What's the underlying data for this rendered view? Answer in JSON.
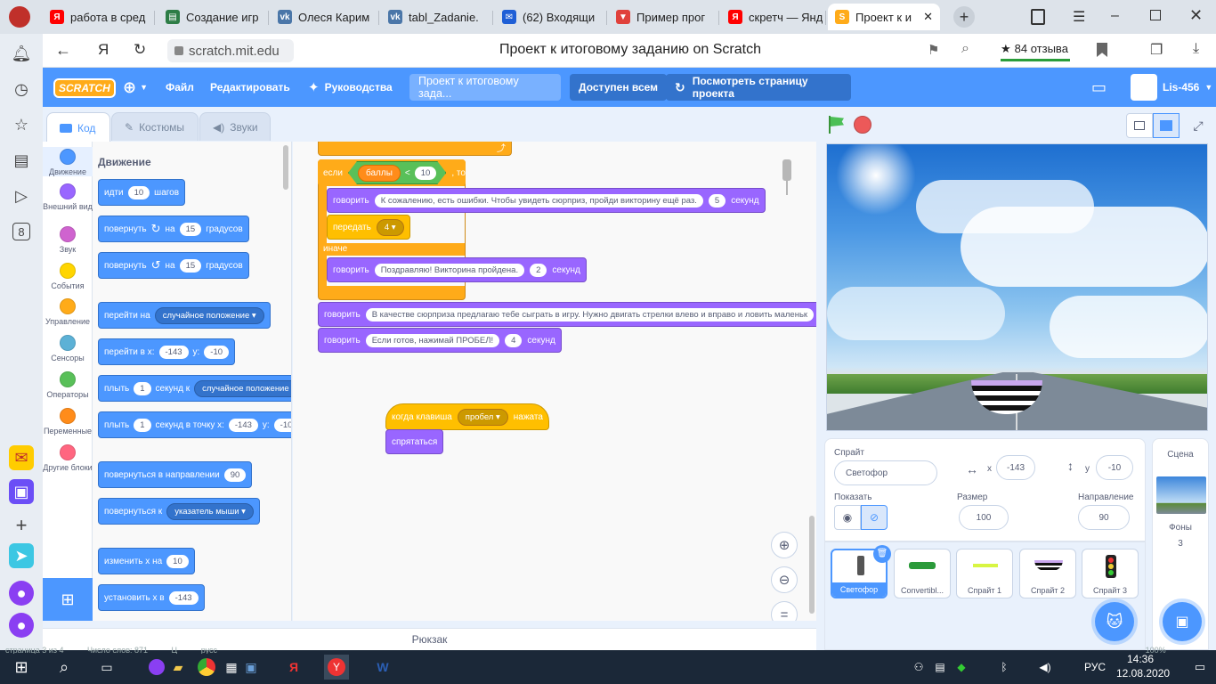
{
  "browser": {
    "tabs": [
      {
        "label": "работа в сред",
        "fav": "Я",
        "color": "#ff0000"
      },
      {
        "label": "Создание игр",
        "fav": "▤",
        "color": "#2d7d46"
      },
      {
        "label": "Олеся Карим",
        "fav": "vk",
        "color": "#4a76a8"
      },
      {
        "label": "tabl_Zadanie.",
        "fav": "vk",
        "color": "#4a76a8"
      },
      {
        "label": "(62) Входящи",
        "fav": "✉",
        "color": "#1f5fd6"
      },
      {
        "label": "Пример прог",
        "fav": "▼",
        "color": "#e0413b"
      },
      {
        "label": "скретч — Янд",
        "fav": "Я",
        "color": "#ff0000"
      },
      {
        "label": "Проект к и",
        "fav": "S",
        "color": "#ffab19"
      }
    ],
    "url": "scratch.mit.edu",
    "page_title": "Проект к итоговому заданию on Scratch",
    "reviews": "84 отзыва"
  },
  "menubar": {
    "logo": "SCRATCH",
    "file": "Файл",
    "edit": "Редактировать",
    "tutorials": "Руководства",
    "project_title": "Проект к итоговому зада...",
    "share": "Доступен всем",
    "see_project": "Посмотреть страницу проекта",
    "username": "Lis-456"
  },
  "editor_tabs": {
    "code": "Код",
    "costumes": "Костюмы",
    "sounds": "Звуки"
  },
  "categories": [
    {
      "label": "Движение",
      "color": "#4c97ff"
    },
    {
      "label": "Внешний вид",
      "color": "#9966ff"
    },
    {
      "label": "Звук",
      "color": "#cf63cf"
    },
    {
      "label": "События",
      "color": "#ffd500"
    },
    {
      "label": "Управление",
      "color": "#ffab19"
    },
    {
      "label": "Сенсоры",
      "color": "#5cb1d6"
    },
    {
      "label": "Операторы",
      "color": "#59c059"
    },
    {
      "label": "Переменные",
      "color": "#ff8c1a"
    },
    {
      "label": "Другие блоки",
      "color": "#ff6680"
    }
  ],
  "palette": {
    "heading": "Движение",
    "move": {
      "t1": "идти",
      "v": "10",
      "t2": "шагов"
    },
    "turn_right": {
      "t1": "повернуть",
      "t2": "на",
      "v": "15",
      "t3": "градусов"
    },
    "turn_left": {
      "t1": "повернуть",
      "t2": "на",
      "v": "15",
      "t3": "градусов"
    },
    "goto": {
      "t1": "перейти на",
      "dd": "случайное положение"
    },
    "goto_xy": {
      "t1": "перейти в x:",
      "x": "-143",
      "t2": "y:",
      "y": "-10"
    },
    "glide": {
      "t1": "плыть",
      "v": "1",
      "t2": "секунд к",
      "dd": "случайное положение"
    },
    "glide_xy": {
      "t1": "плыть",
      "v": "1",
      "t2": "секунд в точку x:",
      "x": "-143",
      "t3": "y:",
      "y": "-10"
    },
    "point_dir": {
      "t1": "повернуться в направлении",
      "v": "90"
    },
    "point_towards": {
      "t1": "повернуться к",
      "dd": "указатель мыши"
    },
    "change_x": {
      "t1": "изменить x на",
      "v": "10"
    },
    "set_x": {
      "t1": "установить x в",
      "v": "-143"
    }
  },
  "script": {
    "if_label": "если",
    "then_label": ", то",
    "var": "баллы",
    "op": "<",
    "op_value": "10",
    "say1": {
      "t1": "говорить",
      "text": "К сожалению, есть ошибки. Чтобы увидеть сюрприз, пройди викторину ещё раз.",
      "v": "5",
      "t2": "секунд"
    },
    "broadcast": {
      "t1": "передать",
      "dd": "4"
    },
    "else_label": "иначе",
    "say2": {
      "t1": "говорить",
      "text": "Поздравляю! Викторина пройдена.",
      "v": "2",
      "t2": "секунд"
    },
    "say3": {
      "t1": "говорить",
      "text": "В качестве сюрприза предлагаю тебе сыграть в игру. Нужно двигать стрелки влево и вправо и ловить маленьк"
    },
    "say4": {
      "t1": "говорить",
      "text": "Если готов, нажимай ПРОБЕЛ!",
      "v": "4",
      "t2": "секунд"
    },
    "hat": {
      "t1": "когда клавиша",
      "dd": "пробел",
      "t2": "нажата"
    },
    "hide": "спрятаться"
  },
  "backpack": "Рюкзак",
  "sprite_info": {
    "sprite_label": "Спрайт",
    "sprite_name": "Светофор",
    "x_label": "x",
    "x": "-143",
    "y_label": "y",
    "y": "-10",
    "show_label": "Показать",
    "size_label": "Размер",
    "size": "100",
    "direction_label": "Направление",
    "direction": "90"
  },
  "sprites": [
    "Светофор",
    "Convertibl...",
    "Спрайт 1",
    "Спрайт 2",
    "Спрайт 3"
  ],
  "scene": {
    "label": "Сцена",
    "backdrops_label": "Фоны",
    "backdrops_count": "3"
  },
  "taskbar": {
    "lang": "РУС",
    "time": "14:36",
    "date": "12.08.2020",
    "behind_text": [
      "страница 3 из 4",
      "Число слов: 871",
      "Ц",
      "русс",
      "100%"
    ]
  }
}
